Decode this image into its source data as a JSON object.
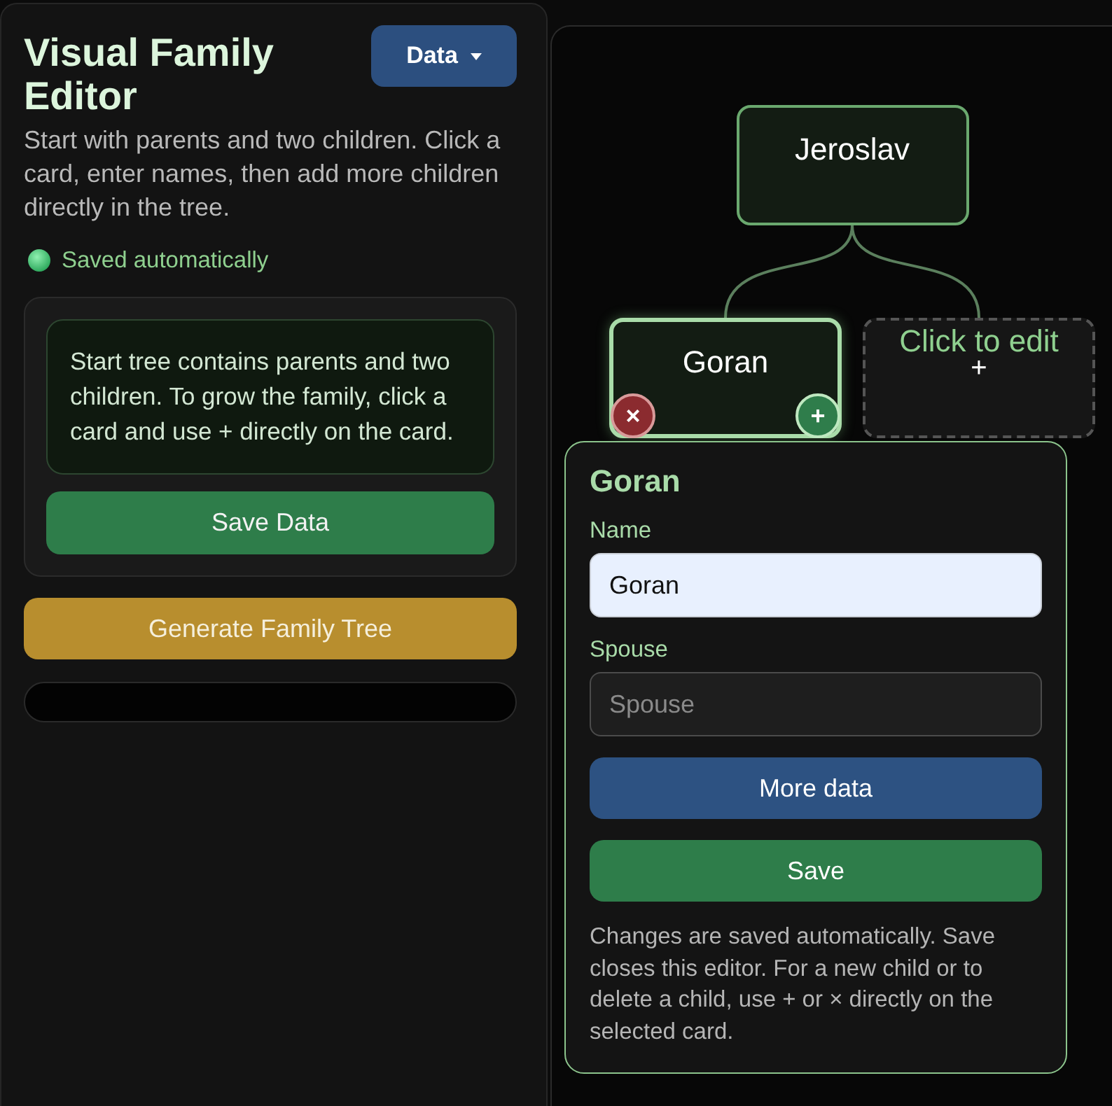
{
  "sidebar": {
    "title": "Visual Family Editor",
    "data_button": "Data",
    "description": "Start with parents and two children. Click a card, enter names, then add more children directly in the tree.",
    "status": "Saved automatically",
    "info_card": {
      "note": "Start tree contains parents and two children. To grow the family, click a card and use + directly on the card.",
      "save_button": "Save Data"
    },
    "generate_button": "Generate Family Tree"
  },
  "tree": {
    "nodes": [
      {
        "kind": "person",
        "name": "Jeroslav",
        "selected": false,
        "children": [
          {
            "kind": "person",
            "name": "Goran",
            "selected": true,
            "actions": [
              {
                "kind": "delete",
                "label": "×"
              },
              {
                "kind": "add",
                "label": "+"
              }
            ]
          },
          {
            "kind": "placeholder",
            "hint": "Click to edit",
            "label": "+",
            "selected": false
          }
        ]
      }
    ]
  },
  "editor": {
    "title": "Goran",
    "fields": [
      {
        "label": "Name",
        "value": "Goran"
      },
      {
        "label": "Spouse",
        "placeholder": "Spouse"
      }
    ],
    "buttons": [
      {
        "kind": "secondary",
        "label": "More data"
      },
      {
        "kind": "primary",
        "label": "Save"
      }
    ],
    "note": "Changes are saved automatically. Save closes this editor. For a new child or to delete a child, use + or × directly on the selected card."
  }
}
